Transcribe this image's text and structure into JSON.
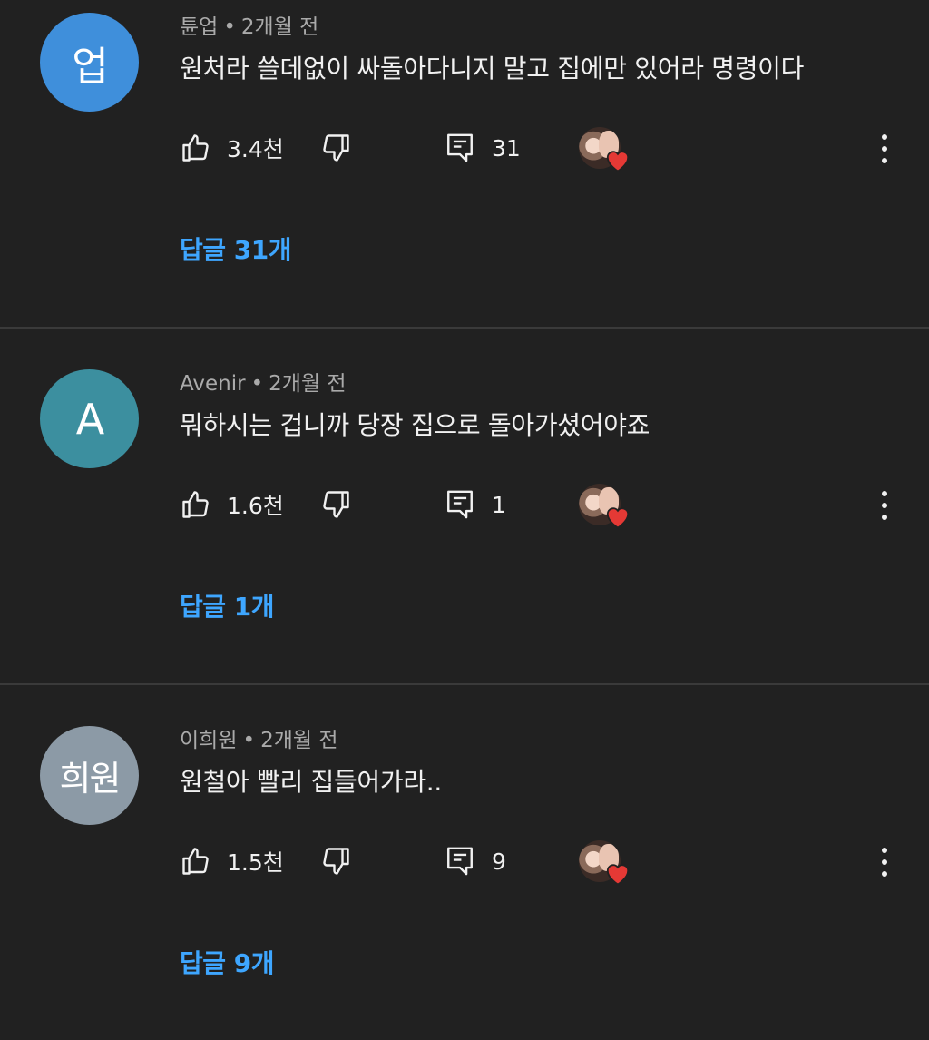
{
  "comments": [
    {
      "avatar_text": "업",
      "avatar_color": "#3f8fdb",
      "author": "튠업",
      "separator": "•",
      "time": "2개월 전",
      "text": "원처라 쓸데없이 싸돌아다니지 말고 집에만 있어라 명령이다",
      "likes": "3.4천",
      "reply_count": "31",
      "replies_link": "답글 31개"
    },
    {
      "avatar_text": "A",
      "avatar_color": "#3c8f9f",
      "author": "Avenir",
      "separator": "•",
      "time": "2개월 전",
      "text": "뭐하시는 겁니까 당장 집으로 돌아가셨어야죠",
      "likes": "1.6천",
      "reply_count": "1",
      "replies_link": "답글 1개"
    },
    {
      "avatar_text": "희원",
      "avatar_color": "#8c9aa6",
      "author": "이희원",
      "separator": "•",
      "time": "2개월 전",
      "text": "원철아 빨리 집들어가라..",
      "likes": "1.5천",
      "reply_count": "9",
      "replies_link": "답글 9개"
    }
  ],
  "icons": {
    "like": "thumbs-up-icon",
    "dislike": "thumbs-down-icon",
    "reply": "comment-icon",
    "creator_heart": "creator-heart-icon",
    "more": "more-vert-icon"
  },
  "colors": {
    "background": "#212121",
    "link": "#3ea6ff",
    "heart": "#e53935",
    "divider": "#3a3a3a"
  }
}
